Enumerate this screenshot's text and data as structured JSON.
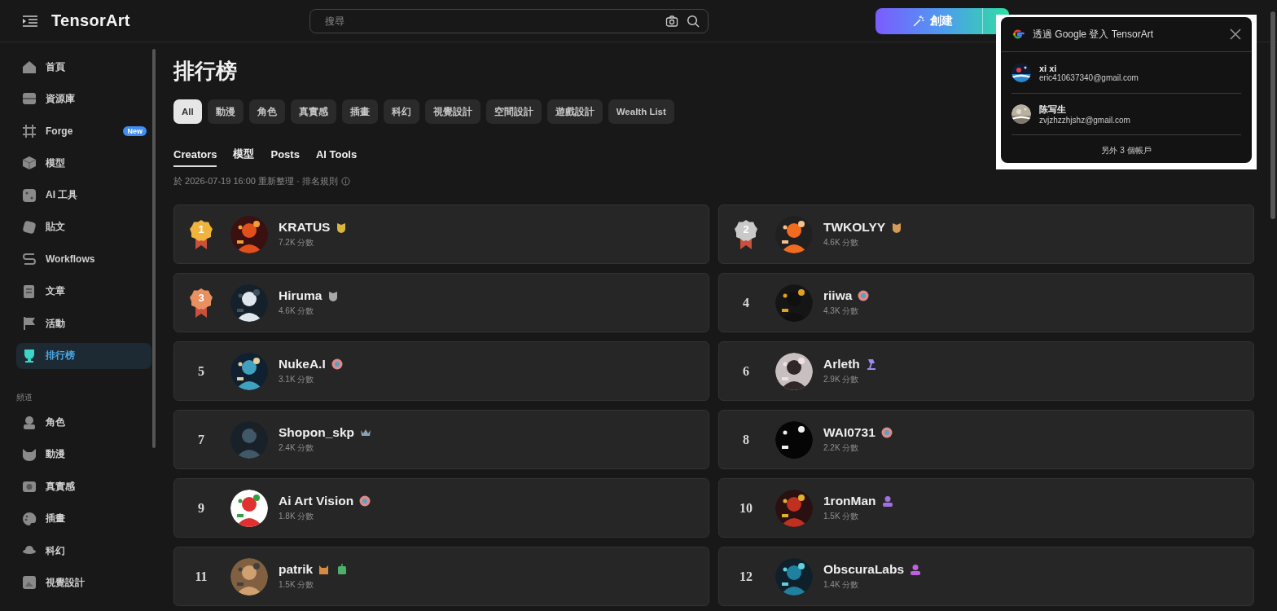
{
  "header": {
    "logo": "TensorArt",
    "search": {
      "placeholder": "搜尋"
    },
    "create_button": "創建"
  },
  "sidebar": {
    "items": [
      {
        "label": "首頁",
        "selected": false
      },
      {
        "label": "資源庫",
        "selected": false
      },
      {
        "label": "Forge",
        "selected": false,
        "badge": "New"
      },
      {
        "label": "模型",
        "selected": false
      },
      {
        "label": "AI 工具",
        "selected": false
      },
      {
        "label": "貼文",
        "selected": false
      },
      {
        "label": "Workflows",
        "selected": false
      },
      {
        "label": "文章",
        "selected": false
      },
      {
        "label": "活動",
        "selected": false
      },
      {
        "label": "排行榜",
        "selected": true
      }
    ],
    "section_title": "頻道",
    "channels": [
      {
        "label": "角色",
        "selected": false
      },
      {
        "label": "動漫",
        "selected": false
      },
      {
        "label": "真實感",
        "selected": false
      },
      {
        "label": "插畫",
        "selected": false
      },
      {
        "label": "科幻",
        "selected": false
      },
      {
        "label": "視覺設計",
        "selected": false
      }
    ]
  },
  "page": {
    "title": "排行榜",
    "filters": [
      {
        "label": "All",
        "selected": true
      },
      {
        "label": "動漫",
        "selected": false
      },
      {
        "label": "角色",
        "selected": false
      },
      {
        "label": "真實感",
        "selected": false
      },
      {
        "label": "插畫",
        "selected": false
      },
      {
        "label": "科幻",
        "selected": false
      },
      {
        "label": "視覺設計",
        "selected": false
      },
      {
        "label": "空間設計",
        "selected": false
      },
      {
        "label": "遊戲設計",
        "selected": false
      },
      {
        "label": "Wealth List",
        "selected": false
      }
    ],
    "tabs": [
      {
        "label": "Creators",
        "selected": true
      },
      {
        "label": "模型",
        "selected": false
      },
      {
        "label": "Posts",
        "selected": false
      },
      {
        "label": "AI Tools",
        "selected": false
      }
    ],
    "updated": "於 2026-07-19 16:00 重新整理 · 排名規則",
    "creators": [
      {
        "rank": "1",
        "kind": "medal",
        "color": "#f0b43c",
        "name": "KRATUS",
        "score": "7.2K 分數",
        "badges": [
          {
            "kind": "shield",
            "color": "#d8b440"
          }
        ]
      },
      {
        "rank": "2",
        "kind": "medal",
        "color": "#c9c9c9",
        "name": "TWKOLYY",
        "score": "4.6K 分數",
        "badges": [
          {
            "kind": "shield",
            "color": "#d59a55"
          }
        ]
      },
      {
        "rank": "3",
        "kind": "medal",
        "color": "#e89060",
        "name": "Hiruma",
        "score": "4.6K 分數",
        "badges": [
          {
            "kind": "shield",
            "color": "#a8a8a8"
          }
        ]
      },
      {
        "rank": "4",
        "kind": "number",
        "name": "riiwa",
        "score": "4.3K 分數",
        "badges": [
          {
            "kind": "flower",
            "color": "#e08a8a"
          }
        ]
      },
      {
        "rank": "5",
        "kind": "number",
        "name": "NukeA.I",
        "score": "3.1K 分數",
        "badges": [
          {
            "kind": "flower",
            "color": "#e08a8a"
          }
        ]
      },
      {
        "rank": "6",
        "kind": "number",
        "name": "Arleth",
        "score": "2.9K 分數",
        "badges": [
          {
            "kind": "lamp",
            "color": "#9b8cf0"
          }
        ]
      },
      {
        "rank": "7",
        "kind": "number",
        "name": "Shopon_skp",
        "score": "2.4K 分數",
        "badges": [
          {
            "kind": "crown",
            "color": "#8aa0b8"
          }
        ]
      },
      {
        "rank": "8",
        "kind": "number",
        "name": "WAI0731",
        "score": "2.2K 分數",
        "badges": [
          {
            "kind": "flower",
            "color": "#e08a8a"
          }
        ]
      },
      {
        "rank": "9",
        "kind": "number",
        "name": "Ai Art Vision",
        "score": "1.8K 分數",
        "badges": [
          {
            "kind": "flower",
            "color": "#e08a8a"
          }
        ]
      },
      {
        "rank": "10",
        "kind": "number",
        "name": "1ronMan",
        "score": "1.5K 分數",
        "badges": [
          {
            "kind": "person",
            "color": "#a070e0"
          }
        ]
      },
      {
        "rank": "11",
        "kind": "number",
        "name": "patrik",
        "score": "1.5K 分數",
        "badges": [
          {
            "kind": "cat",
            "color": "#d88a40"
          },
          {
            "kind": "robot",
            "color": "#4caf6a"
          }
        ]
      },
      {
        "rank": "12",
        "kind": "number",
        "name": "ObscuraLabs",
        "score": "1.4K 分數",
        "badges": [
          {
            "kind": "person",
            "color": "#c060e0"
          }
        ]
      }
    ]
  },
  "google_popup": {
    "title": "透過 Google 登入 TensorArt",
    "accounts": [
      {
        "name": "xi xi",
        "email": "eric410637340@gmail.com"
      },
      {
        "name": "陈写生",
        "email": "zvjzhzzhjshz@gmail.com"
      }
    ],
    "more": "另外 3 個帳戶"
  }
}
